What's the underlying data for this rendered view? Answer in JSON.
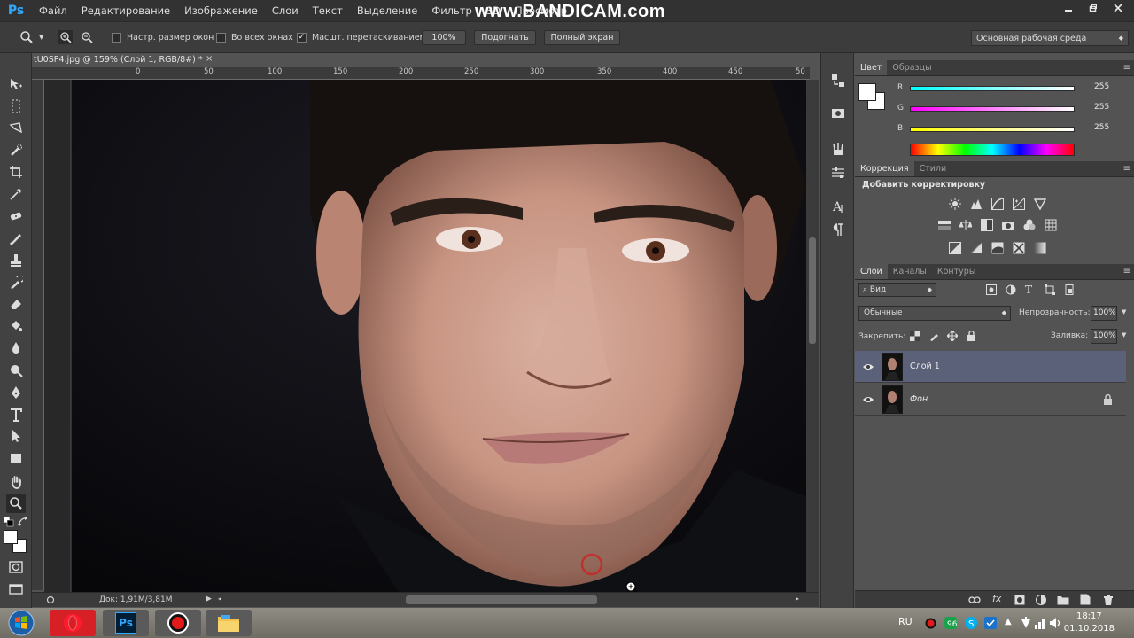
{
  "app": {
    "logo": "Ps",
    "watermark": "www.BANDICAM.com"
  },
  "menu": [
    "Файл",
    "Редактирование",
    "Изображение",
    "Слои",
    "Текст",
    "Выделение",
    "Фильтр",
    "3D",
    "Просмотр"
  ],
  "window_controls": [
    "minimize-icon",
    "restore-icon",
    "close-icon"
  ],
  "options": {
    "tool_icon": "zoom-icon",
    "chk_resize_label": "Настр. размер окон",
    "chk_resize_checked": false,
    "chk_all_windows_label": "Во всех окнах",
    "chk_all_windows_checked": false,
    "chk_scrubby_label": "Масшт. перетаскиванием",
    "chk_scrubby_checked": true,
    "btn_100": "100%",
    "btn_fit": "Подогнать",
    "btn_fill": "Полный экран",
    "workspace": "Основная рабочая среда"
  },
  "document": {
    "tab_title": "tU0SP4.jpg @ 159% (Слой 1, RGB/8#) *",
    "close_glyph": "×",
    "ruler_labels": [
      "0",
      "50",
      "100",
      "150",
      "200",
      "250",
      "300",
      "350",
      "400",
      "450",
      "50"
    ],
    "status": "Док: 1,91M/3,81M"
  },
  "tools": [
    "move-tool-icon",
    "marquee-tool-icon",
    "lasso-tool-icon",
    "quick-selection-tool-icon",
    "crop-tool-icon",
    "eyedropper-tool-icon",
    "healing-brush-tool-icon",
    "brush-tool-icon",
    "clone-stamp-tool-icon",
    "history-brush-tool-icon",
    "eraser-tool-icon",
    "paint-bucket-tool-icon",
    "blur-tool-icon",
    "dodge-tool-icon",
    "pen-tool-icon",
    "type-tool-icon",
    "path-selection-tool-icon",
    "rectangle-tool-icon",
    "hand-tool-icon",
    "zoom-tool-icon"
  ],
  "color_panel": {
    "tabs": [
      "Цвет",
      "Образцы"
    ],
    "r_label": "R",
    "r_value": "255",
    "g_label": "G",
    "g_value": "255",
    "b_label": "B",
    "b_value": "255",
    "fg_color": "#ffffff",
    "bg_color": "#ffffff"
  },
  "adjustments_panel": {
    "tabs": [
      "Коррекция",
      "Стили"
    ],
    "heading": "Добавить корректировку"
  },
  "layers_panel": {
    "tabs": [
      "Слои",
      "Каналы",
      "Контуры"
    ],
    "filter_kind": "Вид",
    "blend_mode": "Обычные",
    "opacity_label": "Непрозрачность:",
    "opacity_value": "100%",
    "lock_label": "Закрепить:",
    "fill_label": "Заливка:",
    "fill_value": "100%",
    "layers": [
      {
        "name": "Слой 1",
        "selected": true,
        "visible": true,
        "locked": false
      },
      {
        "name": "Фон",
        "selected": false,
        "visible": true,
        "locked": true
      }
    ]
  },
  "taskbar": {
    "lang": "RU",
    "time": "18:17",
    "date": "01.10.2018",
    "apps": [
      "windows-start-icon",
      "opera-icon",
      "photoshop-icon",
      "bandicam-record-icon",
      "file-explorer-icon"
    ],
    "ps_label": "Ps"
  },
  "colors": {
    "accent": "#31a8ff",
    "panel_bg": "#535353",
    "selected_layer": "#5b6178"
  }
}
